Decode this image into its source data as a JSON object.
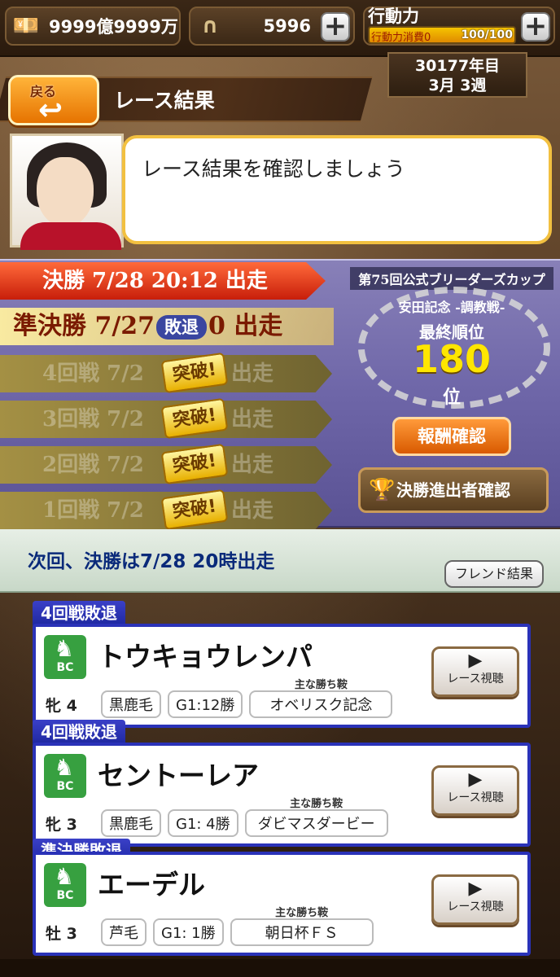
{
  "status": {
    "money": "9999億9999万",
    "horseshoes": "5996",
    "action_title": "行動力",
    "action_sub": "行動力消費0",
    "action_value": "100/100",
    "action_fraction": 1.0,
    "year": "30177年目",
    "week": "3月 3週",
    "money_icon": "money-stack-icon",
    "horseshoe_icon": "horseshoe-icon"
  },
  "header": {
    "back_label": "戻る",
    "title": "レース結果"
  },
  "advisor": {
    "message": "レース結果を確認しましょう"
  },
  "tournament": {
    "rounds": [
      {
        "name": "決勝 7/28 20:12 出走",
        "state": "next"
      },
      {
        "prefix": "準決勝 7/27",
        "badge": "敗退",
        "suffix": "0 出走",
        "state": "lost"
      },
      {
        "text": "4回戦 7/2",
        "tail": "出走",
        "badge": "突破!",
        "state": "passed"
      },
      {
        "text": "3回戦 7/2",
        "tail": "出走",
        "badge": "突破!",
        "state": "passed"
      },
      {
        "text": "2回戦 7/2",
        "tail": "出走",
        "badge": "突破!",
        "state": "passed"
      },
      {
        "text": "1回戦 7/2",
        "tail": "出走",
        "badge": "突破!",
        "state": "passed"
      }
    ],
    "cup_title": "第75回公式ブリーダーズカップ",
    "cup_sub": "安田記念 -調教戦-",
    "rank_label": "最終順位",
    "rank": "180",
    "rank_unit": "位",
    "reward_button": "報酬確認",
    "finalists_button": "決勝進出者確認"
  },
  "info": {
    "next_text": "次回、決勝は7/28 20時出走",
    "friend_button": "フレンド結果"
  },
  "results": [
    {
      "tag": "4回戦敗退",
      "badge": "BC",
      "name": "トウキョウレンパ",
      "sex_age": "牝 4",
      "coat": "黒鹿毛",
      "g1": "G1:12勝",
      "wins_label": "主な勝ち鞍",
      "main_win": "オベリスク記念",
      "watch": "レース視聴"
    },
    {
      "tag": "4回戦敗退",
      "badge": "BC",
      "name": "セントーレア",
      "sex_age": "牝 3",
      "coat": "黒鹿毛",
      "g1": "G1: 4勝",
      "wins_label": "主な勝ち鞍",
      "main_win": "ダビマスダービー",
      "watch": "レース視聴"
    },
    {
      "tag": "準決勝敗退",
      "badge": "BC",
      "name": "エーデル",
      "sex_age": "牡 3",
      "coat": "芦毛",
      "g1": "G1: 1勝",
      "wins_label": "主な勝ち鞍",
      "main_win": "朝日杯ＦＳ",
      "watch": "レース視聴"
    }
  ]
}
